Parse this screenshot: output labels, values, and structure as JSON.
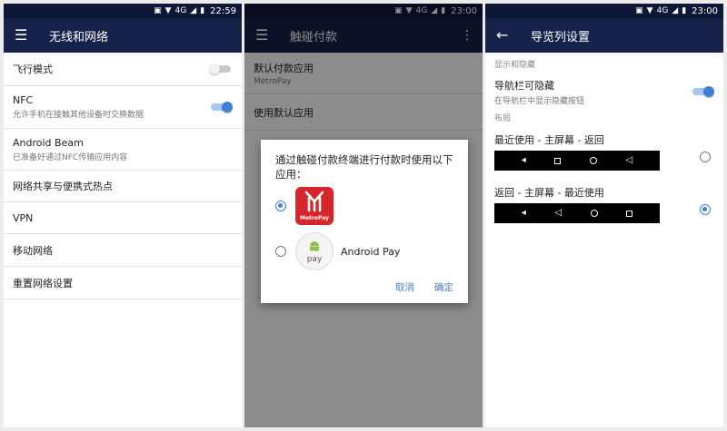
{
  "status": {
    "time1": "22:59",
    "time2": "23:00",
    "time3": "23:00",
    "net": "4G"
  },
  "panel1": {
    "title": "无线和网络",
    "rows": [
      {
        "primary": "飞行模式",
        "secondary": "",
        "toggle": "off"
      },
      {
        "primary": "NFC",
        "secondary": "允许手机在接触其他设备时交换数据",
        "toggle": "on"
      },
      {
        "primary": "Android Beam",
        "secondary": "已准备好通过NFC传输应用内容"
      },
      {
        "primary": "网络共享与便携式热点"
      },
      {
        "primary": "VPN"
      },
      {
        "primary": "移动网络"
      },
      {
        "primary": "重置网络设置"
      }
    ]
  },
  "panel2": {
    "title": "触碰付款",
    "rows": [
      {
        "primary": "默认付款应用",
        "secondary": "MetroPay"
      },
      {
        "primary": "使用默认应用",
        "secondary": ""
      }
    ],
    "dialog": {
      "title": "通过触碰付款终端进行付款时使用以下应用：",
      "options": [
        {
          "label": "",
          "logo_text": "MetroPay",
          "checked": true
        },
        {
          "label": "Android Pay",
          "logo_text": "pay",
          "checked": false
        }
      ],
      "cancel": "取消",
      "ok": "确定"
    }
  },
  "panel3": {
    "title": "导览列设置",
    "section1": "显示和隐藏",
    "hide": {
      "primary": "导航栏可隐藏",
      "secondary": "在导航栏中显示隐藏按钮",
      "toggle": "on"
    },
    "section2": "布局",
    "layouts": [
      {
        "label": "最近使用 - 主屏幕 - 返回",
        "checked": false
      },
      {
        "label": "返回 - 主屏幕 - 最近使用",
        "checked": true
      }
    ]
  },
  "colors": {
    "appbar": "#15224a",
    "statusbar": "#0f1736",
    "accent": "#3f7fd6",
    "metro_red": "#d7262b"
  }
}
